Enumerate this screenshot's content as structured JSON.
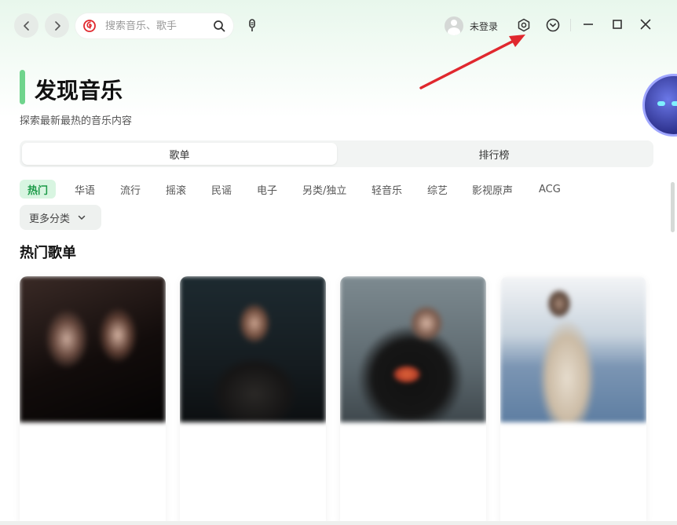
{
  "topbar": {
    "back_icon": "chevron-left-icon",
    "forward_icon": "chevron-right-icon",
    "search_placeholder": "搜索音乐、歌手",
    "user_name": "未登录",
    "settings_icon": "hexagon-settings-icon",
    "dropdown_icon": "chevron-circle-down-icon"
  },
  "header": {
    "title": "发现音乐",
    "subtitle": "探索最新最热的音乐内容"
  },
  "tabs": [
    {
      "label": "歌单",
      "active": true
    },
    {
      "label": "排行榜",
      "active": false
    }
  ],
  "categories": [
    {
      "label": "热门",
      "active": true
    },
    {
      "label": "华语"
    },
    {
      "label": "流行"
    },
    {
      "label": "摇滚"
    },
    {
      "label": "民谣"
    },
    {
      "label": "电子"
    },
    {
      "label": "另类/独立"
    },
    {
      "label": "轻音乐"
    },
    {
      "label": "综艺"
    },
    {
      "label": "影视原声"
    },
    {
      "label": "ACG"
    }
  ],
  "more_categories_label": "更多分类",
  "section_title": "热门歌单",
  "playlists": [
    {
      "name": "",
      "desc": ""
    },
    {
      "name": "",
      "desc": ""
    },
    {
      "name": "",
      "desc": ""
    },
    {
      "name": "",
      "desc": ""
    }
  ],
  "colors": {
    "accent": "#6fd48c",
    "active_chip_bg": "#d8f5e1",
    "active_chip_text": "#1b9a47",
    "annotation_arrow": "#e0282e"
  }
}
